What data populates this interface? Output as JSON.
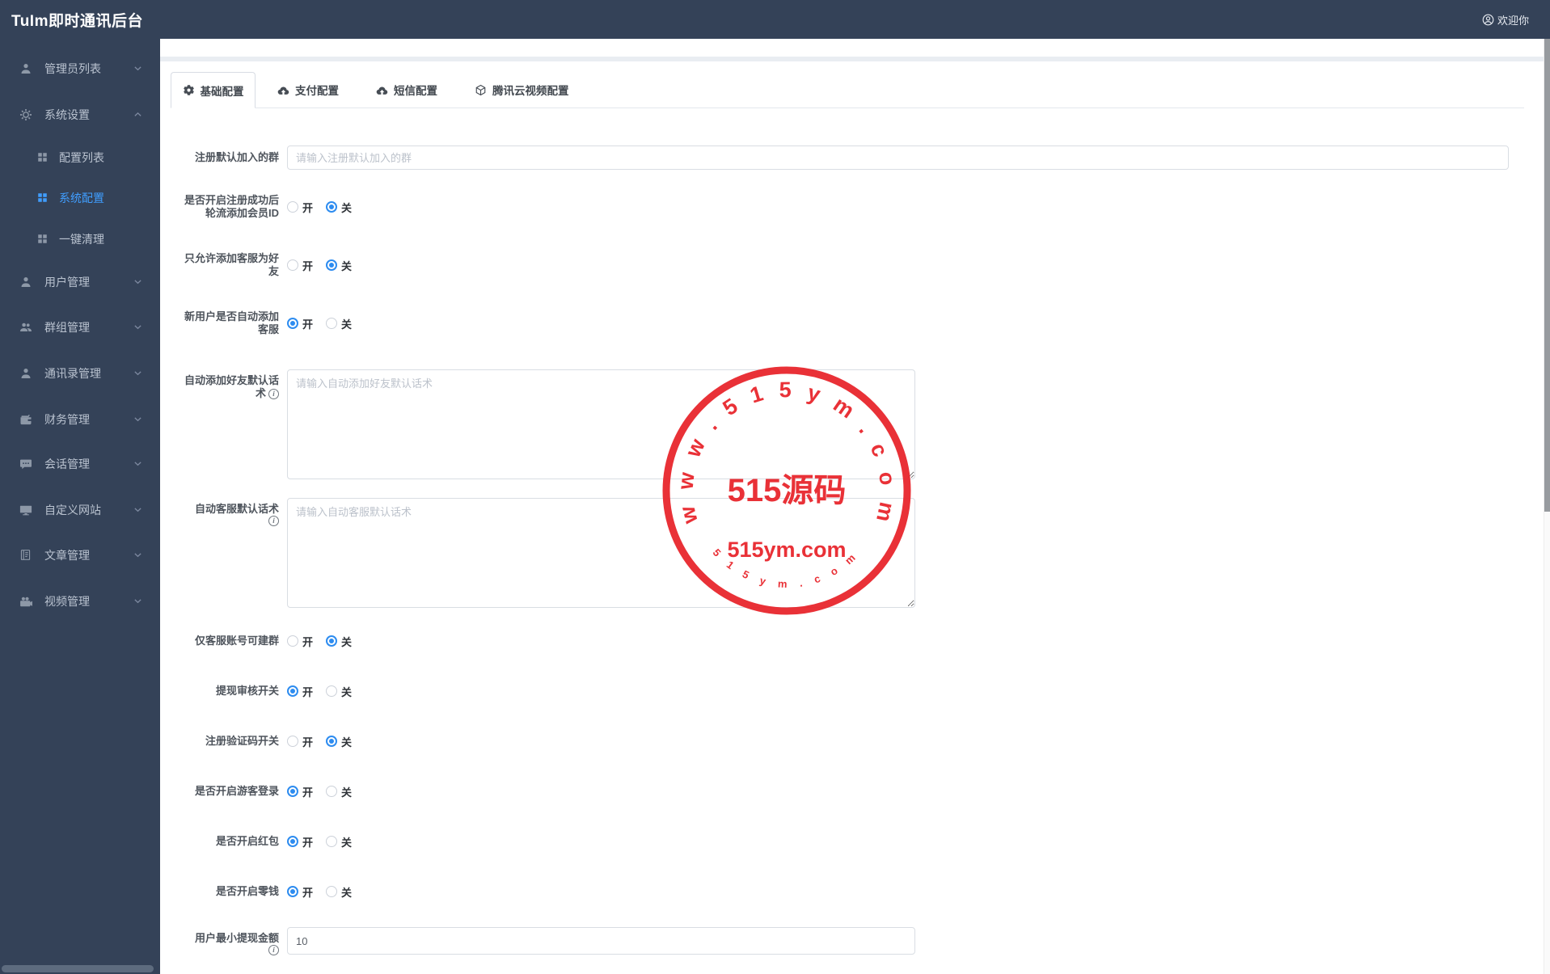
{
  "header": {
    "brand": "TuIm即时通讯后台",
    "welcome": "欢迎你"
  },
  "sidebar": {
    "items": [
      {
        "label": "管理员列表",
        "icon": "admin-user-icon",
        "chevron": "down",
        "type": "top"
      },
      {
        "label": "系统设置",
        "icon": "gear-icon",
        "chevron": "up",
        "type": "top",
        "expanded": true
      },
      {
        "label": "配置列表",
        "icon": "grid-icon",
        "type": "sub",
        "active": false
      },
      {
        "label": "系统配置",
        "icon": "grid-icon",
        "type": "sub",
        "active": true
      },
      {
        "label": "一键清理",
        "icon": "grid-icon",
        "type": "sub",
        "active": false
      },
      {
        "label": "用户管理",
        "icon": "user-icon",
        "chevron": "down",
        "type": "top"
      },
      {
        "label": "群组管理",
        "icon": "users-icon",
        "chevron": "down",
        "type": "top"
      },
      {
        "label": "通讯录管理",
        "icon": "contact-icon",
        "chevron": "down",
        "type": "top"
      },
      {
        "label": "财务管理",
        "icon": "wallet-icon",
        "chevron": "down",
        "type": "top"
      },
      {
        "label": "会话管理",
        "icon": "chat-icon",
        "chevron": "down",
        "type": "top"
      },
      {
        "label": "自定义网站",
        "icon": "monitor-icon",
        "chevron": "down",
        "type": "top"
      },
      {
        "label": "文章管理",
        "icon": "article-icon",
        "chevron": "down",
        "type": "top"
      },
      {
        "label": "视频管理",
        "icon": "video-icon",
        "chevron": "down",
        "type": "top"
      }
    ]
  },
  "tabs": [
    {
      "label": "基础配置",
      "icon": "gear-solid-icon",
      "active": true
    },
    {
      "label": "支付配置",
      "icon": "cloud-upload-icon",
      "active": false
    },
    {
      "label": "短信配置",
      "icon": "cloud-upload-icon",
      "active": false
    },
    {
      "label": "腾讯云视频配置",
      "icon": "cube-icon",
      "active": false
    }
  ],
  "radio_options": {
    "on": "开",
    "off": "关"
  },
  "form": {
    "rows": [
      {
        "id": "default-join-group",
        "label": "注册默认加入的群",
        "lines": [
          "注册默认加入的群"
        ],
        "type": "input",
        "placeholder": "请输入注册默认加入的群",
        "value": "",
        "info": false
      },
      {
        "id": "register-rotate-add-member",
        "label": "是否开启注册成功后轮流添加会员ID",
        "lines": [
          "是否开启注册成功后",
          "轮流添加会员ID"
        ],
        "type": "radio",
        "selected": "off",
        "info": false
      },
      {
        "id": "only-add-service-as-friend",
        "label": "只允许添加客服为好友",
        "lines": [
          "只允许添加客服为好",
          "友"
        ],
        "type": "radio",
        "selected": "off",
        "info": false
      },
      {
        "id": "new-user-auto-add-service",
        "label": "新用户是否自动添加客服",
        "lines": [
          "新用户是否自动添加",
          "客服"
        ],
        "type": "radio",
        "selected": "on",
        "info": false
      },
      {
        "id": "auto-add-friend-words",
        "label": "自动添加好友默认话术",
        "lines": [
          "自动添加好友默认话",
          "术"
        ],
        "type": "textarea",
        "placeholder": "请输入自动添加好友默认话术",
        "value": "",
        "info": true
      },
      {
        "id": "auto-service-words",
        "label": "自动客服默认话术",
        "lines": [
          "自动客服默认话术"
        ],
        "type": "textarea",
        "placeholder": "请输入自动客服默认话术",
        "value": "",
        "info": true
      },
      {
        "id": "only-service-create-group",
        "label": "仅客服账号可建群",
        "lines": [
          "仅客服账号可建群"
        ],
        "type": "radio",
        "selected": "off",
        "info": false
      },
      {
        "id": "withdraw-audit-switch",
        "label": "提现审核开关",
        "lines": [
          "提现审核开关"
        ],
        "type": "radio",
        "selected": "on",
        "info": false
      },
      {
        "id": "register-captcha-switch",
        "label": "注册验证码开关",
        "lines": [
          "注册验证码开关"
        ],
        "type": "radio",
        "selected": "off",
        "info": false
      },
      {
        "id": "guest-login-switch",
        "label": "是否开启游客登录",
        "lines": [
          "是否开启游客登录"
        ],
        "type": "radio",
        "selected": "on",
        "info": false
      },
      {
        "id": "red-packet-switch",
        "label": "是否开启红包",
        "lines": [
          "是否开启红包"
        ],
        "type": "radio",
        "selected": "on",
        "info": false
      },
      {
        "id": "change-money-switch",
        "label": "是否开启零钱",
        "lines": [
          "是否开启零钱"
        ],
        "type": "radio",
        "selected": "on",
        "info": false
      },
      {
        "id": "min-withdraw-amount",
        "label": "用户最小提现金额",
        "lines": [
          "用户最小提现金额"
        ],
        "type": "input",
        "placeholder": "",
        "value": "10",
        "info": true
      }
    ]
  },
  "watermark": {
    "arc_text": "w w w . 5 1 5 y m . c o m",
    "center_text": "515源码",
    "line2_text": "515ym.com",
    "bottom_arc_text": "5 1 5 y m . c o m",
    "color": "#e8262d"
  },
  "colors": {
    "accent_blue": "#409eff",
    "radio_blue": "#2d8cf0",
    "sidebar_bg": "#344258",
    "band_gray": "#e9edf2"
  }
}
